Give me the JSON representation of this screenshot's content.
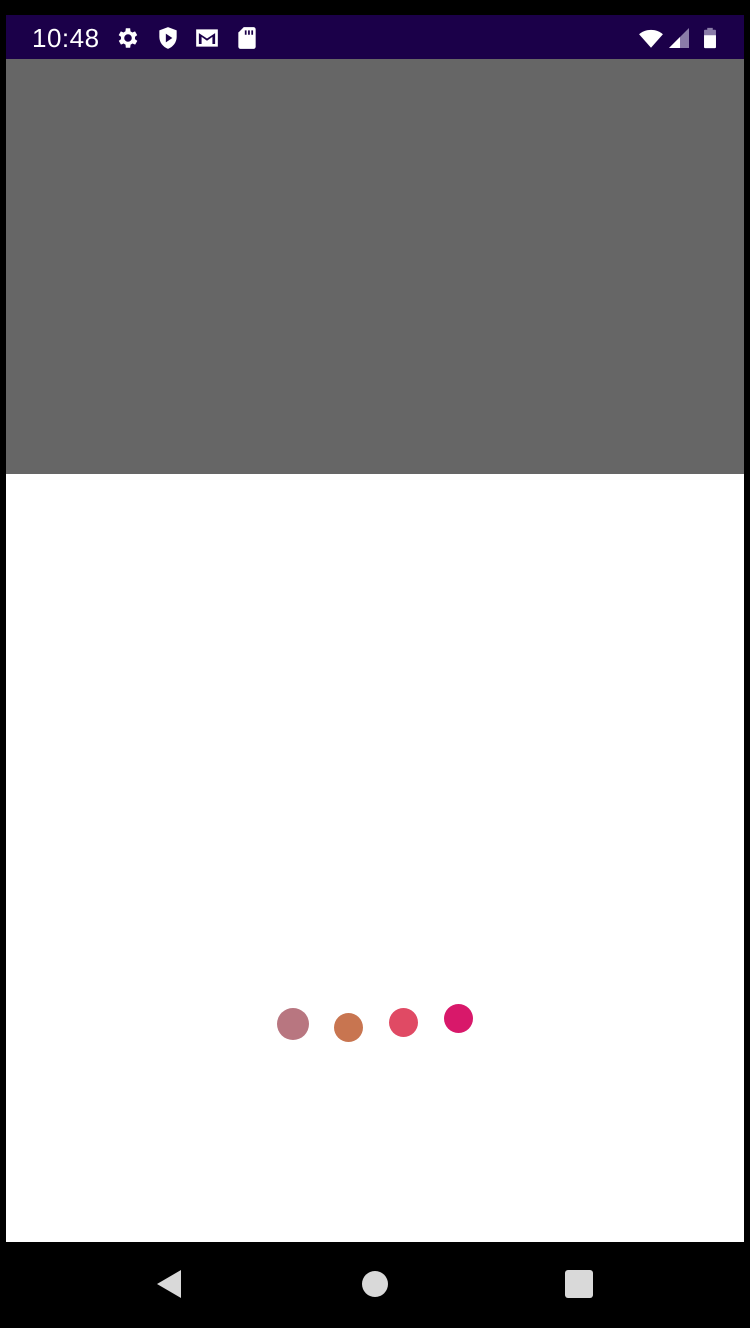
{
  "status_bar": {
    "time": "10:48",
    "background": "#1b0049",
    "icons_left": [
      "settings-gear-icon",
      "shield-play-icon",
      "gmail-icon",
      "sd-card-icon"
    ],
    "icons_right": [
      "wifi-icon",
      "cellular-signal-icon",
      "battery-icon"
    ]
  },
  "media_area": {
    "background": "#666666"
  },
  "content_area": {
    "background": "#ffffff",
    "loading_dots": [
      {
        "color": "#b87680"
      },
      {
        "color": "#c87550"
      },
      {
        "color": "#e04a64"
      },
      {
        "color": "#d8186a"
      }
    ]
  },
  "nav_bar": {
    "buttons": [
      "back-icon",
      "home-icon",
      "recents-icon"
    ],
    "icon_color": "#d9d9d9"
  }
}
